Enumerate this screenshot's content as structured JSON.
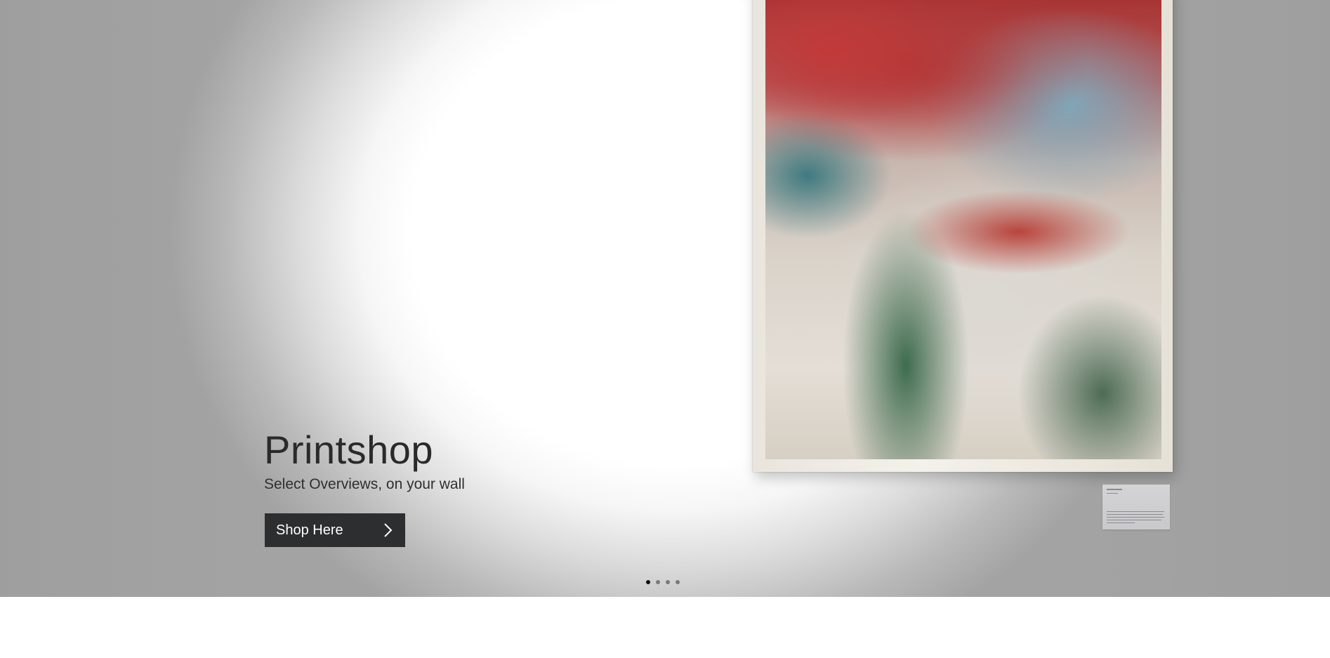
{
  "hero": {
    "title": "Printshop",
    "subtitle": "Select Overviews, on your wall",
    "cta_label": "Shop Here",
    "cta_icon": "chevron-right-icon",
    "artwork": "framed-satellite-print",
    "plaque": "info-plaque"
  },
  "carousel": {
    "slide_count": 4,
    "active_index": 0,
    "dot_colors": {
      "active": "#111111",
      "inactive": "#7a7a7a"
    }
  },
  "colors": {
    "button_bg": "#2d2e30",
    "button_text": "#ffffff",
    "heading_text": "#2a2a2a"
  }
}
